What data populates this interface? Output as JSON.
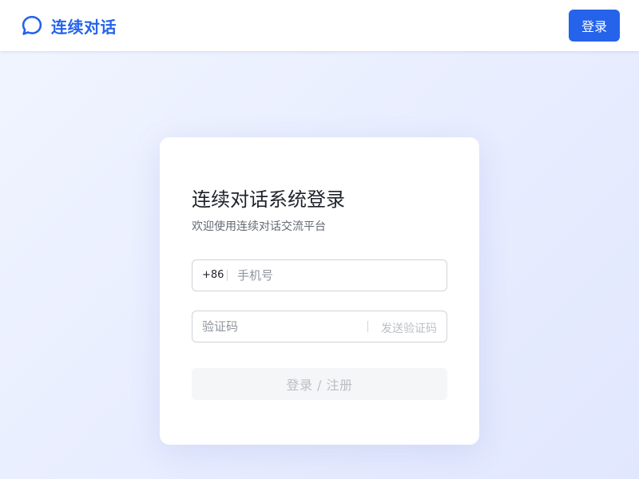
{
  "header": {
    "brand_name": "连续对话",
    "brand_icon": "chat-bubble-icon",
    "login_label": "登录"
  },
  "login_card": {
    "title": "连续对话系统登录",
    "subtitle": "欢迎使用连续对话交流平台",
    "phone": {
      "country_code": "+86",
      "placeholder": "手机号",
      "value": ""
    },
    "code": {
      "placeholder": "验证码",
      "value": "",
      "send_label": "发送验证码"
    },
    "submit_label": "登录 / 注册"
  },
  "colors": {
    "accent": "#2563eb",
    "background_start": "#f1f5ff",
    "background_end": "#e1e7fd",
    "disabled_text": "#bbbfc4"
  }
}
